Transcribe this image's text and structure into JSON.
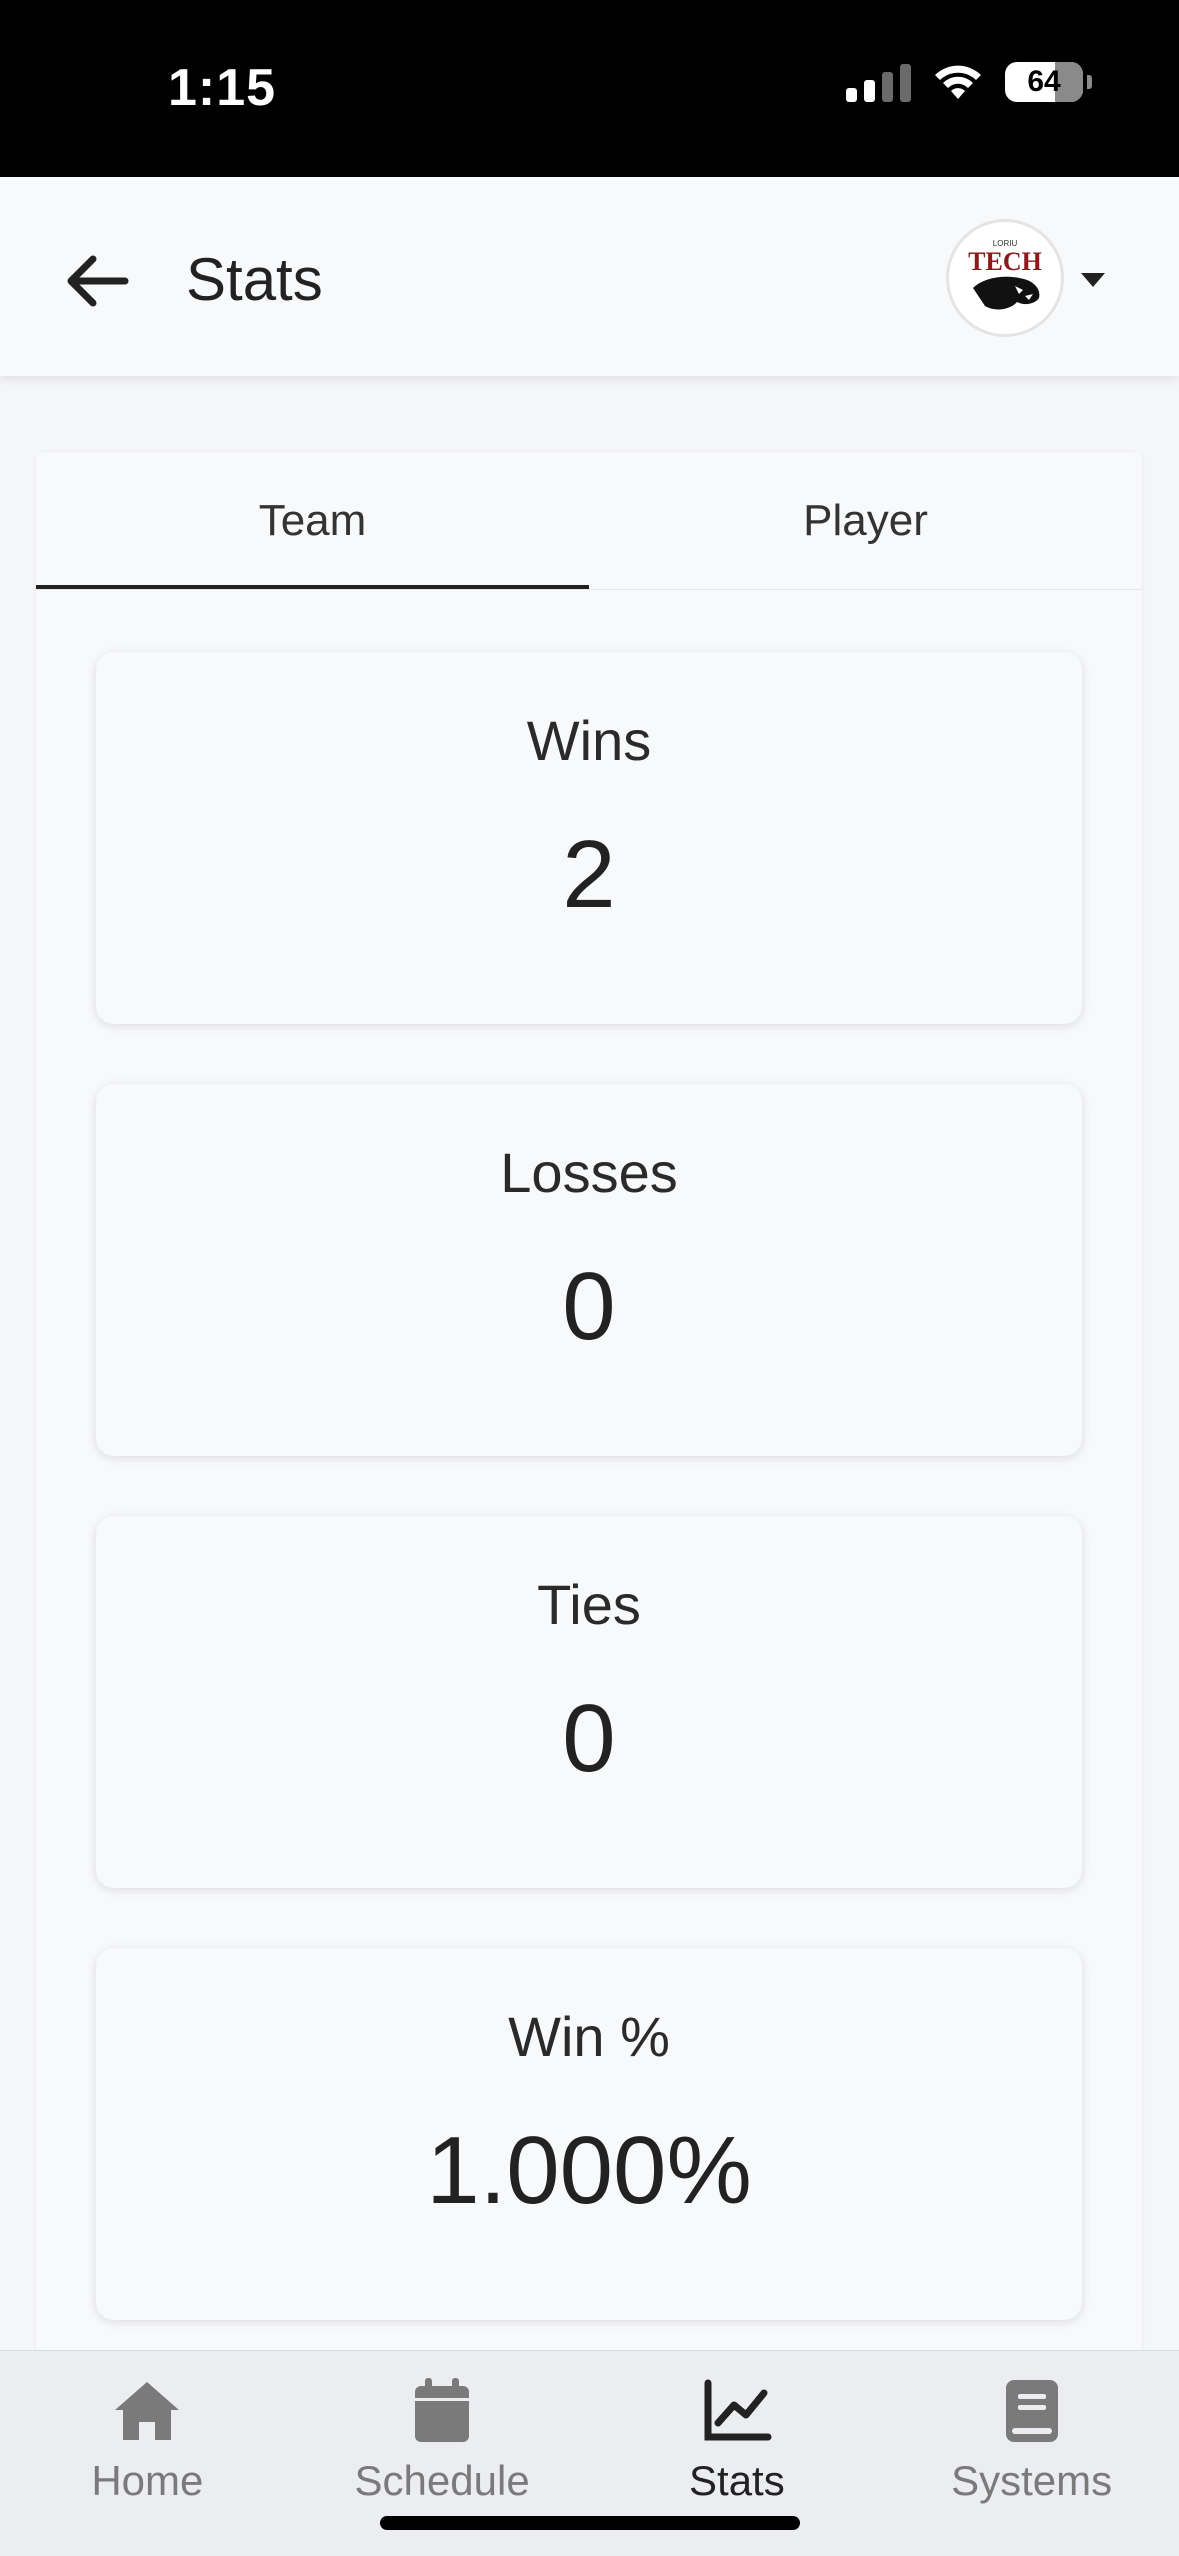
{
  "status_bar": {
    "time": "1:15",
    "battery": "64"
  },
  "header": {
    "title": "Stats",
    "back_icon": "arrow-left-icon",
    "logo_text": "TECH",
    "logo_small_text": "LORIU"
  },
  "tabs": [
    {
      "label": "Team",
      "active": true
    },
    {
      "label": "Player",
      "active": false
    }
  ],
  "stats": [
    {
      "label": "Wins",
      "value": "2"
    },
    {
      "label": "Losses",
      "value": "0"
    },
    {
      "label": "Ties",
      "value": "0"
    },
    {
      "label": "Win %",
      "value": "1.000%"
    }
  ],
  "bottom_nav": [
    {
      "label": "Home",
      "icon": "home-icon",
      "active": false
    },
    {
      "label": "Schedule",
      "icon": "calendar-icon",
      "active": false
    },
    {
      "label": "Stats",
      "icon": "chart-line-icon",
      "active": true
    },
    {
      "label": "Systems",
      "icon": "book-icon",
      "active": false
    }
  ],
  "colors": {
    "accent": "#222222",
    "inactive": "#7a7a7a",
    "logo_red": "#8b1a1a"
  }
}
